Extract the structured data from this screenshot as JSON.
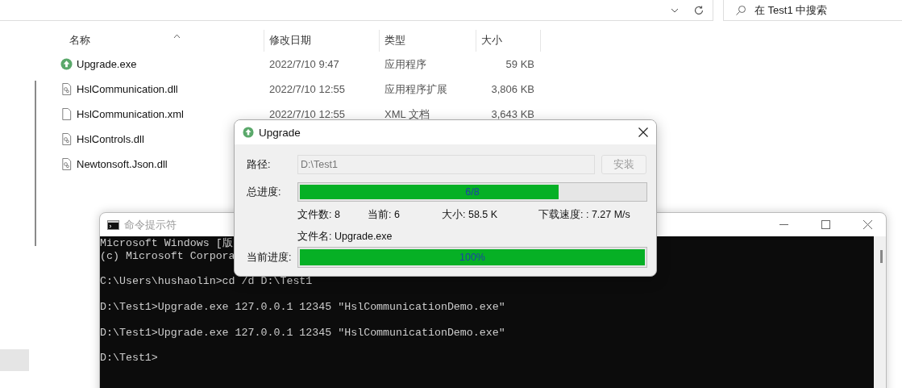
{
  "explorer": {
    "search": {
      "placeholder": "在 Test1 中搜索"
    },
    "columns": [
      {
        "label": "名称",
        "sorted": true
      },
      {
        "label": "修改日期",
        "sorted": false
      },
      {
        "label": "类型",
        "sorted": false
      },
      {
        "label": "大小",
        "sorted": false
      }
    ],
    "files": [
      {
        "name": "Upgrade.exe",
        "kind": "app",
        "date": "2022/7/10 9:47",
        "type": "应用程序",
        "size": "59 KB"
      },
      {
        "name": "HslCommunication.dll",
        "kind": "library",
        "date": "2022/7/10 12:55",
        "type": "应用程序扩展",
        "size": "3,806 KB"
      },
      {
        "name": "HslCommunication.xml",
        "kind": "document",
        "date": "2022/7/10 12:55",
        "type": "XML 文档",
        "size": "3,643 KB"
      },
      {
        "name": "HslControls.dll",
        "kind": "library"
      },
      {
        "name": "Newtonsoft.Json.dll",
        "kind": "library"
      }
    ]
  },
  "console": {
    "title": "命令提示符",
    "blocks": [
      [
        "Microsoft Windows [版",
        "(c) Microsoft Corpora"
      ],
      [
        "C:\\Users\\hushaolin>cd /d D:\\Test1"
      ],
      [
        "D:\\Test1>Upgrade.exe 127.0.0.1 12345 \"HslCommunicationDemo.exe\""
      ],
      [
        "D:\\Test1>Upgrade.exe 127.0.0.1 12345 \"HslCommunicationDemo.exe\""
      ],
      [
        "D:\\Test1>"
      ]
    ]
  },
  "dialog": {
    "title": "Upgrade",
    "path": {
      "label": "路径:",
      "value": "D:\\Test1"
    },
    "install_button": {
      "label": "安装",
      "disabled": true
    },
    "total_progress": {
      "label": "总进度:",
      "level": 0.75,
      "text": "6/8"
    },
    "stats": [
      "文件数: 8",
      "当前: 6",
      "大小: 58.5 K",
      "下载速度: : 7.27 M/s"
    ],
    "file_name": "文件名: Upgrade.exe",
    "current_progress": {
      "label": "当前进度:",
      "level": 1,
      "text": "100%"
    }
  }
}
